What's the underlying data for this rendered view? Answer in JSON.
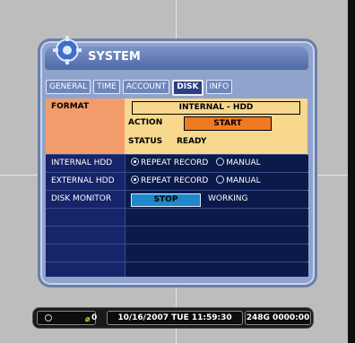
{
  "window": {
    "title": "SYSTEM"
  },
  "tabs": [
    {
      "label": "GENERAL",
      "active": false
    },
    {
      "label": "TIME",
      "active": false
    },
    {
      "label": "ACCOUNT",
      "active": false
    },
    {
      "label": "DISK",
      "active": true
    },
    {
      "label": "INFO",
      "active": false
    }
  ],
  "format": {
    "label": "FORMAT",
    "target": "INTERNAL - HDD",
    "action_label": "ACTION",
    "action_button": "START",
    "status_label": "STATUS",
    "status_value": "READY"
  },
  "rows": {
    "internal_hdd": {
      "label": "INTERNAL HDD",
      "option1": "REPEAT RECORD",
      "option2": "MANUAL",
      "selected": "REPEAT RECORD"
    },
    "external_hdd": {
      "label": "EXTERNAL HDD",
      "option1": "REPEAT RECORD",
      "option2": "MANUAL",
      "selected": "REPEAT RECORD"
    },
    "disk_monitor": {
      "label": "DISK MONITOR",
      "button": "STOP",
      "status": "WORKING"
    }
  },
  "statusbar": {
    "net_count": "0",
    "datetime": "10/16/2007 TUE 11:59:30",
    "disk_info": "248G  0000:00"
  },
  "colors": {
    "format_label_bg": "#f39c6b",
    "format_area_bg": "#f7d88d",
    "start_button": "#f07a21",
    "stop_button": "#1e88c8",
    "window_frame": "#8fa3cc"
  }
}
